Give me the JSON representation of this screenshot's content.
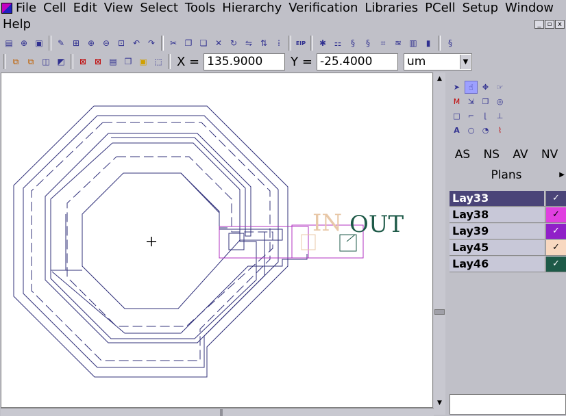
{
  "menu": {
    "row1": [
      "File",
      "Cell",
      "Edit",
      "View",
      "Select",
      "Tools",
      "Hierarchy",
      "Verification",
      "Libraries",
      "PCell",
      "Setup",
      "Window"
    ],
    "row2": [
      "Help"
    ]
  },
  "window_controls": [
    "_",
    "▫",
    "x"
  ],
  "toolbar1": [
    {
      "icon": "new-icon",
      "glyph": "▤"
    },
    {
      "icon": "open-icon",
      "glyph": "⊕"
    },
    {
      "icon": "save-icon",
      "glyph": "▣"
    },
    {
      "icon": "pencil-icon",
      "glyph": "✎"
    },
    {
      "icon": "fit-icon",
      "glyph": "⊞"
    },
    {
      "icon": "zoom-in-icon",
      "glyph": "⊕"
    },
    {
      "icon": "zoom-out-icon",
      "glyph": "⊖"
    },
    {
      "icon": "zoom-box-icon",
      "glyph": "⊡"
    },
    {
      "icon": "undo-icon",
      "glyph": "↶"
    },
    {
      "icon": "redo-icon",
      "glyph": "↷"
    },
    {
      "icon": "cut-icon",
      "glyph": "✂"
    },
    {
      "icon": "copy-icon",
      "glyph": "❐"
    },
    {
      "icon": "paste-icon",
      "glyph": "❏"
    },
    {
      "icon": "delete-icon",
      "glyph": "✕"
    },
    {
      "icon": "rotate-icon",
      "glyph": "↻"
    },
    {
      "icon": "mirror-icon",
      "glyph": "⇋"
    },
    {
      "icon": "flip-icon",
      "glyph": "⇅"
    },
    {
      "icon": "grid-icon",
      "glyph": "⁞"
    },
    {
      "icon": "eip-icon",
      "glyph": "EIP"
    },
    {
      "icon": "bulb-icon",
      "glyph": "✱"
    },
    {
      "icon": "select-all-icon",
      "glyph": "⚏"
    },
    {
      "icon": "route-icon",
      "glyph": "§"
    },
    {
      "icon": "route2-icon",
      "glyph": "§"
    },
    {
      "icon": "connect-icon",
      "glyph": "⌗"
    },
    {
      "icon": "drc-icon",
      "glyph": "≋"
    },
    {
      "icon": "view3d-icon",
      "glyph": "▥"
    },
    {
      "icon": "cross-section-icon",
      "glyph": "▮"
    },
    {
      "icon": "route3-icon",
      "glyph": "§"
    }
  ],
  "coords": {
    "x_label": "X =",
    "x_value": "135.9000",
    "y_label": "Y =",
    "y_value": "-25.4000",
    "unit": "um"
  },
  "plans": {
    "tabs": [
      "AS",
      "NS",
      "AV",
      "NV"
    ],
    "title": "Plans"
  },
  "layers": [
    {
      "name": "Lay33",
      "color": "#4a4478",
      "selected": true
    },
    {
      "name": "Lay38",
      "color": "#e040e0",
      "selected": false
    },
    {
      "name": "Lay39",
      "color": "#9020c8",
      "selected": false
    },
    {
      "name": "Lay45",
      "color": "#f8d8c0",
      "selected": false
    },
    {
      "name": "Lay46",
      "color": "#1e5a48",
      "selected": false
    }
  ],
  "labels": {
    "in": "IN",
    "out": "OUT"
  },
  "colors": {
    "line": "#30307a",
    "label_in": "#e8c8a8",
    "label_out": "#1e5a48",
    "pad": "#b030c0"
  }
}
